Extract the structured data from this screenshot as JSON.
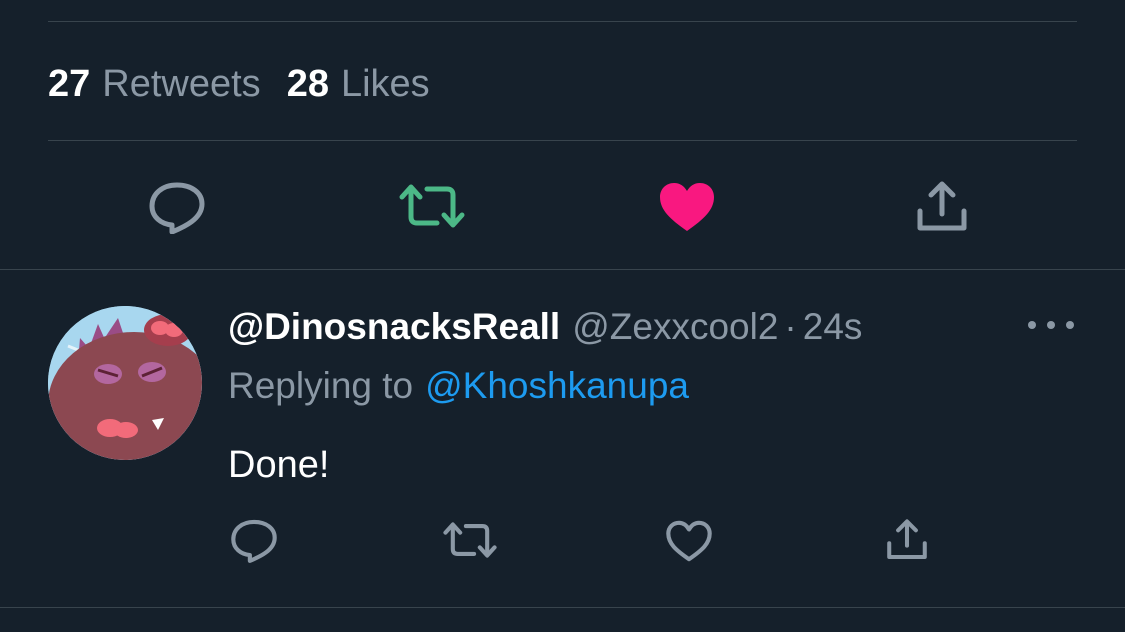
{
  "stats": {
    "retweets_count": "27",
    "retweets_label": "Retweets",
    "likes_count": "28",
    "likes_label": "Likes"
  },
  "main_actions": [
    {
      "name": "reply",
      "icon": "comment-icon",
      "color": "#8b98a5",
      "state": "default"
    },
    {
      "name": "retweet",
      "icon": "retweet-icon",
      "color": "#4cb887",
      "state": "active"
    },
    {
      "name": "like",
      "icon": "heart-icon",
      "color": "#f91880",
      "state": "active"
    },
    {
      "name": "share",
      "icon": "share-icon",
      "color": "#8b98a5",
      "state": "default"
    }
  ],
  "reply": {
    "display_name": "@DinosnacksReall",
    "handle": "@Zexxcool2",
    "separator": "·",
    "time": "24s",
    "replying_prefix": "Replying to",
    "replying_to": "@Khoshkanupa",
    "text": "Done!",
    "avatar_icon": "dinosaur-avatar",
    "actions": [
      {
        "name": "reply",
        "icon": "comment-icon",
        "color": "#8b98a5"
      },
      {
        "name": "retweet",
        "icon": "retweet-icon",
        "color": "#8b98a5"
      },
      {
        "name": "like",
        "icon": "heart-outline-icon",
        "color": "#8b98a5"
      },
      {
        "name": "share",
        "icon": "share-icon",
        "color": "#8b98a5"
      }
    ]
  },
  "colors": {
    "background": "#15202b",
    "divider": "#38444d",
    "muted": "#8b98a5",
    "link": "#1d9bf0",
    "retweet_active": "#4cb887",
    "like_active": "#f91880"
  }
}
